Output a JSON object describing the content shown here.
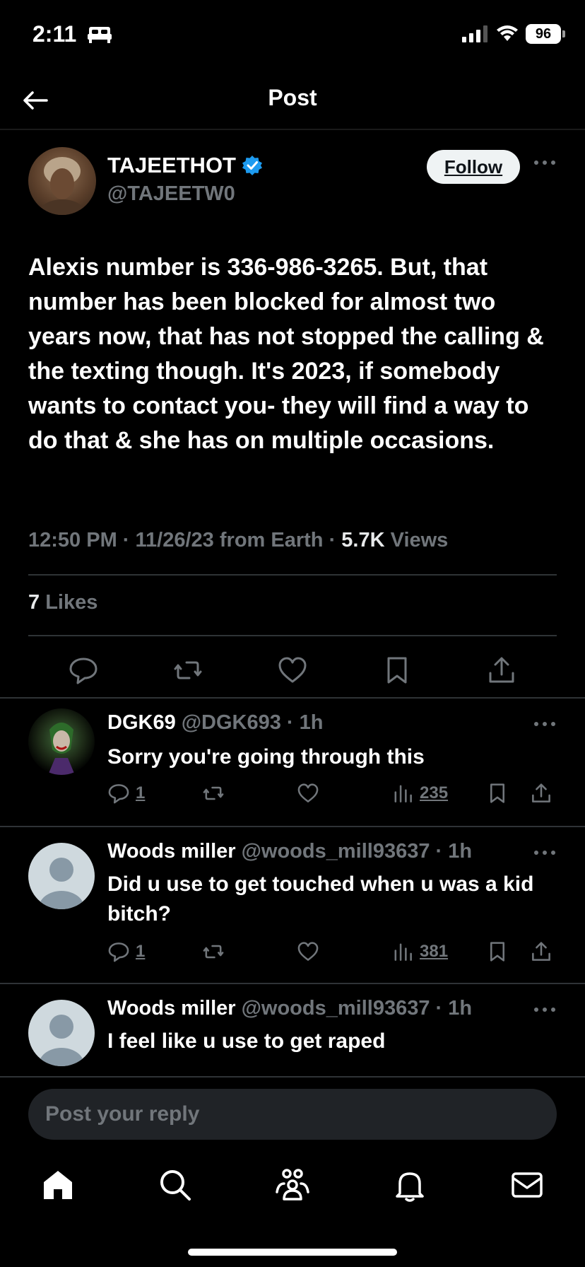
{
  "status": {
    "time": "2:11",
    "battery": "96"
  },
  "header": {
    "title": "Post"
  },
  "post": {
    "author_name": "TAJEETHOT",
    "author_handle": "@TAJEETW0",
    "follow_label": "Follow",
    "text": "Alexis number is 336-986-3265. But, that number has been blocked for almost two years now, that has not stopped the calling & the texting though. It's 2023, if somebody wants to contact you- they will find a way to do that & she has on multiple occasions.",
    "time": "12:50 PM",
    "date": "11/26/23",
    "source": "from Earth",
    "views_count": "5.7K",
    "views_label": "Views",
    "likes_count": "7",
    "likes_label": "Likes"
  },
  "replies": [
    {
      "name": "DGK69",
      "handle": "@DGK693",
      "time": "1h",
      "text": "Sorry you're going through this",
      "reply_count": "1",
      "views": "235"
    },
    {
      "name": "Woods miller",
      "handle": "@woods_mill93637",
      "time": "1h",
      "text": "Did u use to get touched when u was a kid bitch?",
      "reply_count": "1",
      "views": "381"
    },
    {
      "name": "Woods miller",
      "handle": "@woods_mill93637",
      "time": "1h",
      "text": "I feel like u use to get raped"
    }
  ],
  "compose": {
    "placeholder": "Post your reply"
  },
  "colors": {
    "background": "#000000",
    "muted": "#71767b",
    "verified": "#1d9bf0"
  },
  "icons": [
    "back-arrow-icon",
    "verified-badge-icon",
    "more-icon",
    "reply-icon",
    "repost-icon",
    "like-icon",
    "bookmark-icon",
    "share-icon",
    "views-icon",
    "home-icon",
    "search-icon",
    "communities-icon",
    "notifications-icon",
    "messages-icon"
  ]
}
